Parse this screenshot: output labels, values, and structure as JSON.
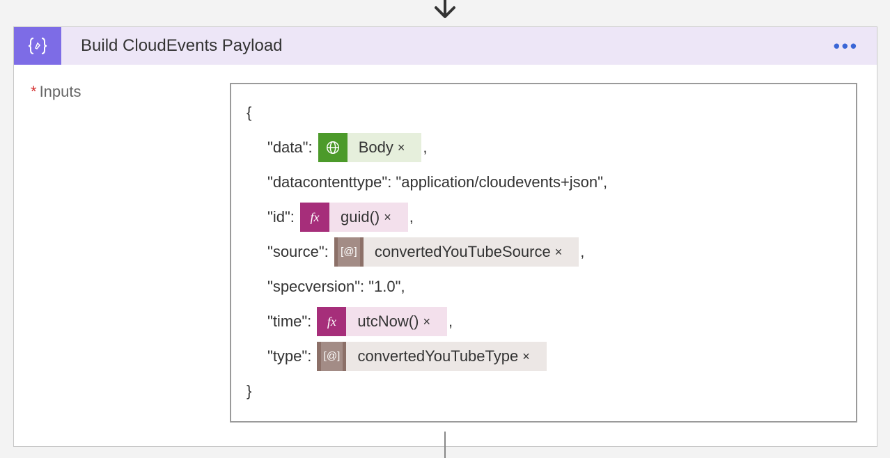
{
  "header": {
    "title": "Build CloudEvents Payload"
  },
  "label": {
    "required_mark": "*",
    "inputs": "Inputs"
  },
  "json": {
    "open_brace": "{",
    "close_brace": "}",
    "comma": ",",
    "quote": "\"",
    "colon": ":",
    "keys": {
      "data": "data",
      "datacontenttype": "datacontenttype",
      "id": "id",
      "source": "source",
      "specversion": "specversion",
      "time": "time",
      "type": "type"
    },
    "values": {
      "datacontenttype": "application/cloudevents+json",
      "specversion": "1.0"
    }
  },
  "tokens": {
    "body": "Body",
    "guid": "guid()",
    "source": "convertedYouTubeSource",
    "utcnow": "utcNow()",
    "type": "convertedYouTubeType",
    "fx": "fx",
    "close": "×"
  }
}
